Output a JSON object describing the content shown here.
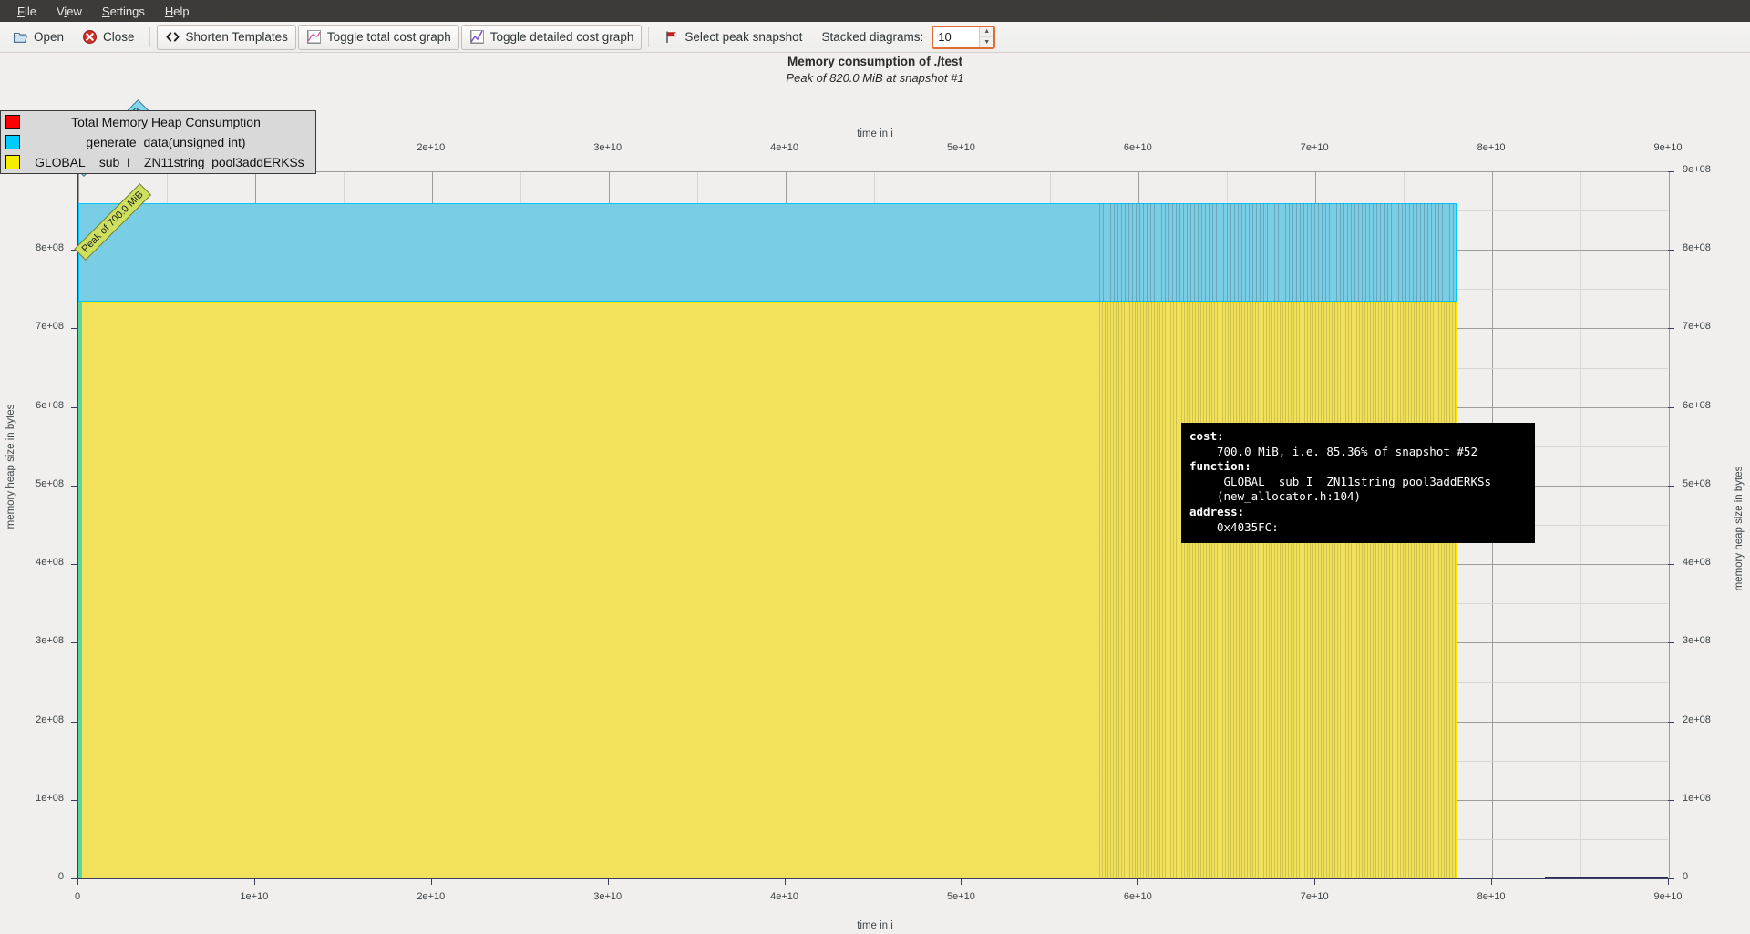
{
  "menu": {
    "items": [
      {
        "label": "File",
        "accel": "F"
      },
      {
        "label": "View",
        "accel": "V"
      },
      {
        "label": "Settings",
        "accel": "S"
      },
      {
        "label": "Help",
        "accel": "H"
      }
    ]
  },
  "toolbar": {
    "open_label": "Open",
    "close_label": "Close",
    "shorten_templates_label": "Shorten Templates",
    "toggle_total_label": "Toggle total cost graph",
    "toggle_detailed_label": "Toggle detailed cost graph",
    "select_peak_label": "Select peak snapshot",
    "stacked_diagrams_label": "Stacked diagrams:",
    "stacked_diagrams_value": "10",
    "icons": {
      "open": "open-folder-icon",
      "close": "close-circle-icon",
      "shorten": "angle-brackets-icon",
      "total_graph": "line-chart-icon",
      "detailed_graph": "line-chart-icon",
      "peak": "red-flag-icon",
      "spin_up": "chevron-up-icon",
      "spin_down": "chevron-down-icon"
    }
  },
  "chart_header": {
    "title": "Memory consumption of ./test",
    "subtitle": "Peak of 820.0 MiB at snapshot #1"
  },
  "legend": {
    "entries": [
      {
        "label": "Total Memory Heap Consumption",
        "color": "#ff0000"
      },
      {
        "label": "generate_data(unsigned int)",
        "color": "#00ccff"
      },
      {
        "label": "_GLOBAL__sub_I__ZN11string_pool3addERKSs",
        "color": "#f5ee00"
      }
    ]
  },
  "annotations": [
    {
      "text": "Peak of 120.0 MiB",
      "color": "#7fd8ef"
    },
    {
      "text": "Peak of 700.0 MiB",
      "color": "#cfe05f"
    }
  ],
  "tooltip": {
    "cost_key": "cost:",
    "cost_value": "700.0 MiB, i.e. 85.36% of snapshot #52",
    "function_key": "function:",
    "function_value_line1": "_GLOBAL__sub_I__ZN11string_pool3addERKSs",
    "function_value_line2": "(new_allocator.h:104)",
    "address_key": "address:",
    "address_value": "0x4035FC:"
  },
  "chart_data": {
    "type": "area",
    "title": "Memory consumption of ./test",
    "subtitle": "Peak of 820.0 MiB at snapshot #1",
    "xlabel": "time in i",
    "ylabel": "memory heap size in bytes",
    "xlabel_top": "time in i",
    "ylabel_right": "memory heap size in bytes",
    "xlim": [
      0,
      90000000000
    ],
    "ylim": [
      0,
      900000000
    ],
    "x_ticks": [
      "0",
      "1e+10",
      "2e+10",
      "3e+10",
      "4e+10",
      "5e+10",
      "6e+10",
      "7e+10",
      "8e+10",
      "9e+10"
    ],
    "x_ticks_top": [
      "1e+10",
      "2e+10",
      "3e+10",
      "4e+10",
      "5e+10",
      "6e+10",
      "7e+10",
      "8e+10",
      "9e+10"
    ],
    "y_ticks": [
      "0",
      "1e+08",
      "2e+08",
      "3e+08",
      "4e+08",
      "5e+08",
      "6e+08",
      "7e+08",
      "8e+08",
      "9e+08"
    ],
    "grid": true,
    "legend_position": "top-left",
    "data_x_start": 0,
    "data_x_end": 78000000000,
    "series": [
      {
        "name": "_GLOBAL__sub_I__ZN11string_pool3addERKSs",
        "color": "#f2e15a",
        "border": "#ffe400",
        "stack_from": 0,
        "stack_to": 734003200,
        "peak_label": "Peak of 700.0 MiB"
      },
      {
        "name": "generate_data(unsigned int)",
        "color": "#79cde5",
        "border": "#00c8ff",
        "stack_from": 734003200,
        "stack_to": 859832320,
        "peak_label": "Peak of 120.0 MiB"
      },
      {
        "name": "Total Memory Heap Consumption",
        "color": "#ff0000",
        "stack_from": 0,
        "stack_to": 859832320
      }
    ]
  }
}
